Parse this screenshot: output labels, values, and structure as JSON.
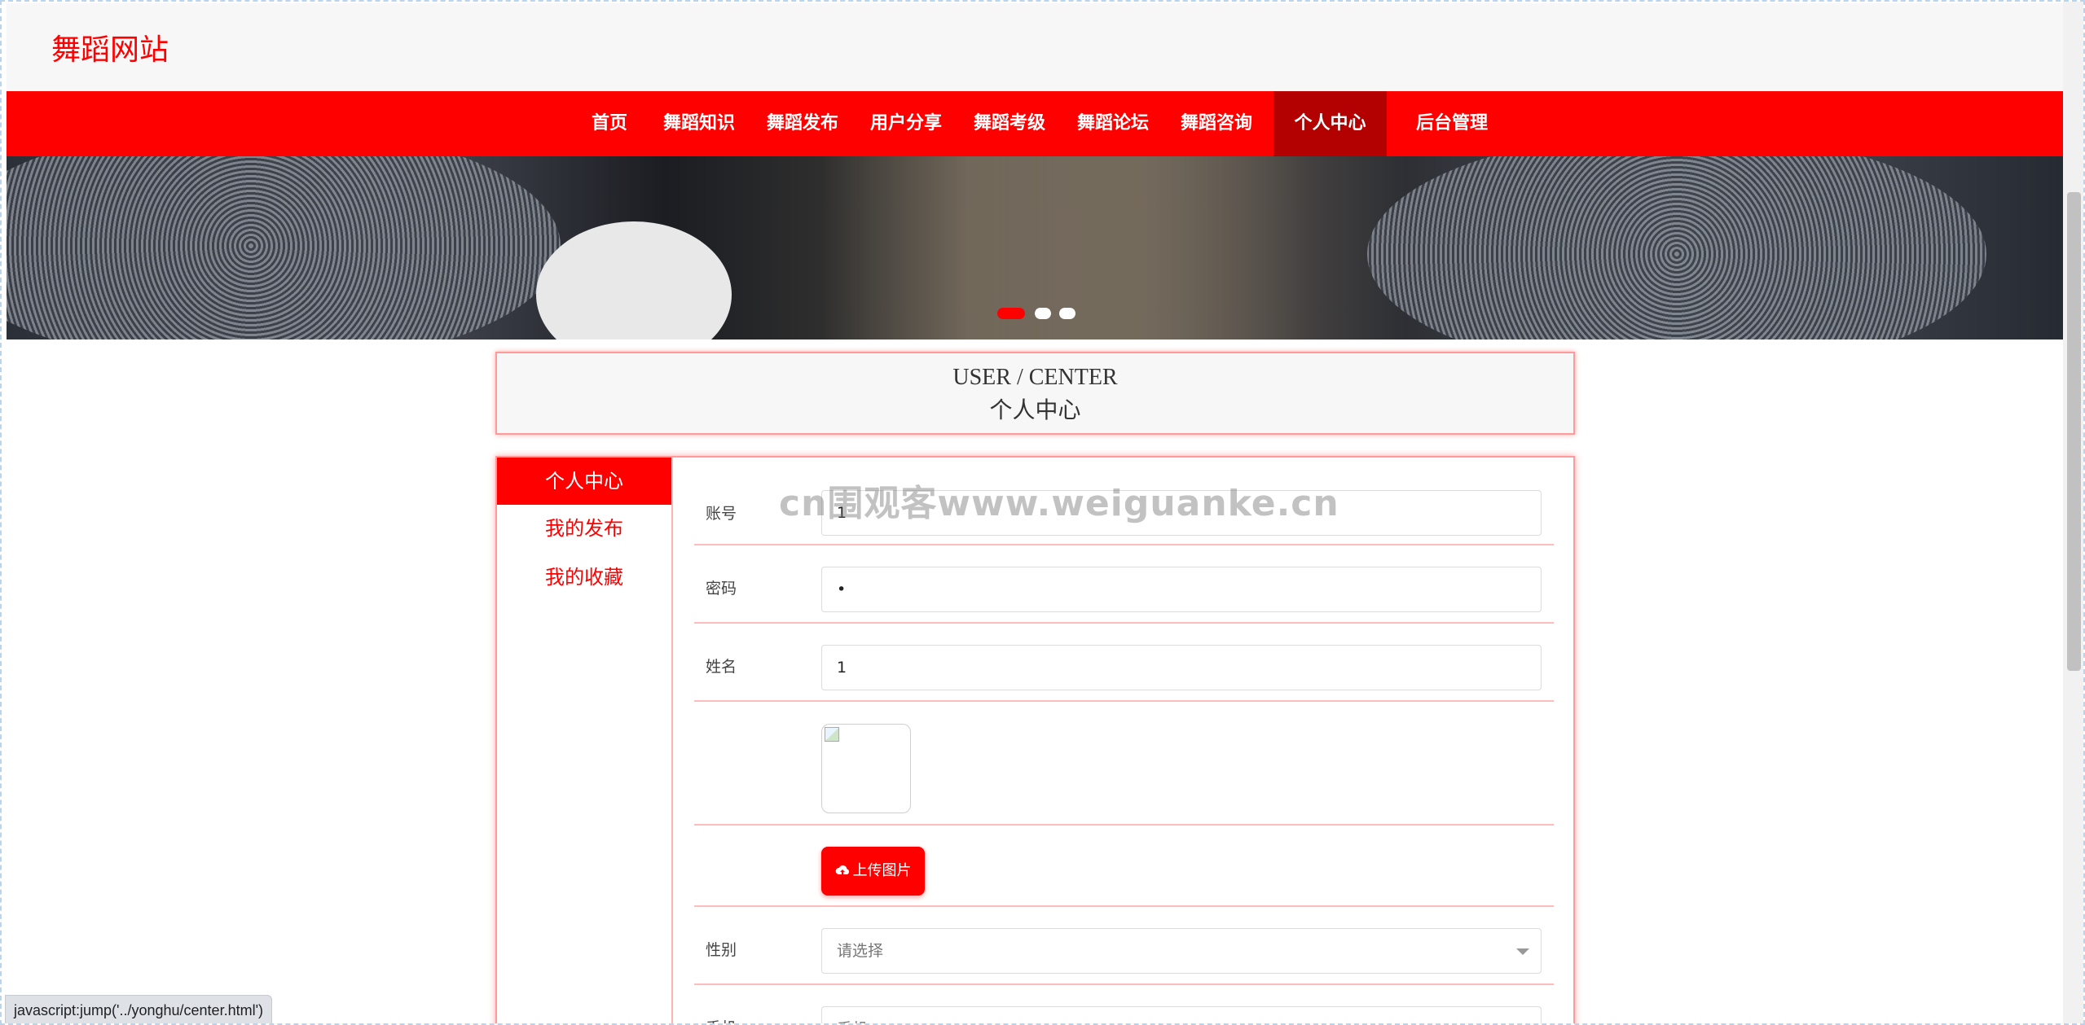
{
  "site": {
    "title": "舞蹈网站"
  },
  "nav": {
    "items": [
      {
        "label": "首页"
      },
      {
        "label": "舞蹈知识"
      },
      {
        "label": "舞蹈发布"
      },
      {
        "label": "用户分享"
      },
      {
        "label": "舞蹈考级"
      },
      {
        "label": "舞蹈论坛"
      },
      {
        "label": "舞蹈咨询"
      },
      {
        "label": "个人中心",
        "active": true
      },
      {
        "label": "后台管理"
      }
    ]
  },
  "banner": {
    "slide_count": 3,
    "active_slide": 1
  },
  "center_title": {
    "en": "USER / CENTER",
    "cn": "个人中心"
  },
  "sidebar": {
    "items": [
      {
        "label": "个人中心",
        "active": true
      },
      {
        "label": "我的发布"
      },
      {
        "label": "我的收藏"
      }
    ]
  },
  "form": {
    "account": {
      "label": "账号",
      "value": "1"
    },
    "password": {
      "label": "密码",
      "value": "•"
    },
    "name": {
      "label": "姓名",
      "value": "1"
    },
    "upload_label": "上传图片",
    "gender": {
      "label": "性别",
      "placeholder": "请选择"
    },
    "next_row": {
      "label": "手机",
      "placeholder": "手机"
    }
  },
  "watermark": "cn围观客www.weiguanke.cn",
  "status_bar": "javascript:jump('../yonghu/center.html')",
  "colors": {
    "accent": "#ff0000",
    "nav_active": "#b30000",
    "border_pink": "#ff9a9a"
  },
  "icons": {
    "upload": "cloud-upload-icon",
    "select_caret": "chevron-down-icon",
    "broken_image": "broken-image-icon"
  }
}
